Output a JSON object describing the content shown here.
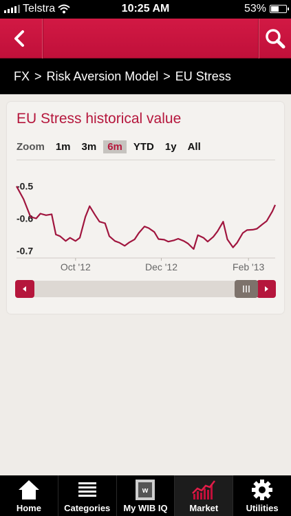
{
  "status_bar": {
    "carrier": "Telstra",
    "time": "10:25 AM",
    "battery_percent": "53%",
    "battery_level": 0.53
  },
  "navbar": {
    "back_icon": "chevron-left-icon",
    "search_icon": "search-icon"
  },
  "breadcrumb": {
    "items": [
      "FX",
      "Risk Aversion Model",
      "EU Stress"
    ],
    "separator": ">"
  },
  "card": {
    "title": "EU Stress historical value",
    "zoom_label": "Zoom",
    "zoom_options": [
      "1m",
      "3m",
      "6m",
      "YTD",
      "1y",
      "All"
    ],
    "zoom_selected": "6m"
  },
  "chart_data": {
    "type": "line",
    "title": "",
    "xlabel": "",
    "ylabel": "",
    "y_ticks": [
      "-0.5",
      "-0.6",
      "-0.7"
    ],
    "x_ticks": [
      "Oct '12",
      "Dec '12",
      "Feb '13"
    ],
    "ylim": [
      -0.71,
      -0.49
    ],
    "x_range": [
      "2012-08-20",
      "2013-02-20"
    ],
    "x_tick_dates": [
      "2012-10-01",
      "2012-12-01",
      "2013-02-01"
    ],
    "grid": false,
    "series": [
      {
        "color": "#a0153e",
        "x": [
          "2012-08-20",
          "2012-08-25",
          "2012-08-30",
          "2012-09-03",
          "2012-09-06",
          "2012-09-10",
          "2012-09-14",
          "2012-09-17",
          "2012-09-20",
          "2012-09-24",
          "2012-09-27",
          "2012-10-01",
          "2012-10-04",
          "2012-10-08",
          "2012-10-11",
          "2012-10-15",
          "2012-10-18",
          "2012-10-22",
          "2012-10-25",
          "2012-10-29",
          "2012-11-01",
          "2012-11-05",
          "2012-11-08",
          "2012-11-12",
          "2012-11-15",
          "2012-11-19",
          "2012-11-22",
          "2012-11-26",
          "2012-11-29",
          "2012-12-03",
          "2012-12-06",
          "2012-12-10",
          "2012-12-13",
          "2012-12-17",
          "2012-12-20",
          "2012-12-24",
          "2012-12-27",
          "2012-12-31",
          "2013-01-03",
          "2013-01-07",
          "2013-01-10",
          "2013-01-14",
          "2013-01-17",
          "2013-01-21",
          "2013-01-24",
          "2013-01-28",
          "2013-01-31",
          "2013-02-04",
          "2013-02-07",
          "2013-02-11",
          "2013-02-14",
          "2013-02-18",
          "2013-02-20"
        ],
        "values": [
          -0.5,
          -0.54,
          -0.595,
          -0.6,
          -0.585,
          -0.59,
          -0.587,
          -0.65,
          -0.655,
          -0.67,
          -0.66,
          -0.67,
          -0.66,
          -0.595,
          -0.562,
          -0.59,
          -0.61,
          -0.615,
          -0.655,
          -0.67,
          -0.675,
          -0.685,
          -0.675,
          -0.665,
          -0.645,
          -0.625,
          -0.63,
          -0.642,
          -0.664,
          -0.666,
          -0.672,
          -0.668,
          -0.663,
          -0.67,
          -0.678,
          -0.695,
          -0.652,
          -0.66,
          -0.672,
          -0.657,
          -0.64,
          -0.61,
          -0.665,
          -0.69,
          -0.675,
          -0.645,
          -0.636,
          -0.635,
          -0.632,
          -0.618,
          -0.608,
          -0.578,
          -0.558
        ]
      }
    ]
  },
  "tabbar": {
    "tabs": [
      {
        "label": "Home",
        "icon": "home-icon"
      },
      {
        "label": "Categories",
        "icon": "list-icon"
      },
      {
        "label": "My WIB IQ",
        "icon": "wib-badge-icon"
      },
      {
        "label": "Market",
        "icon": "market-chart-icon"
      },
      {
        "label": "Utilities",
        "icon": "gear-icon"
      }
    ],
    "active": "Market"
  }
}
